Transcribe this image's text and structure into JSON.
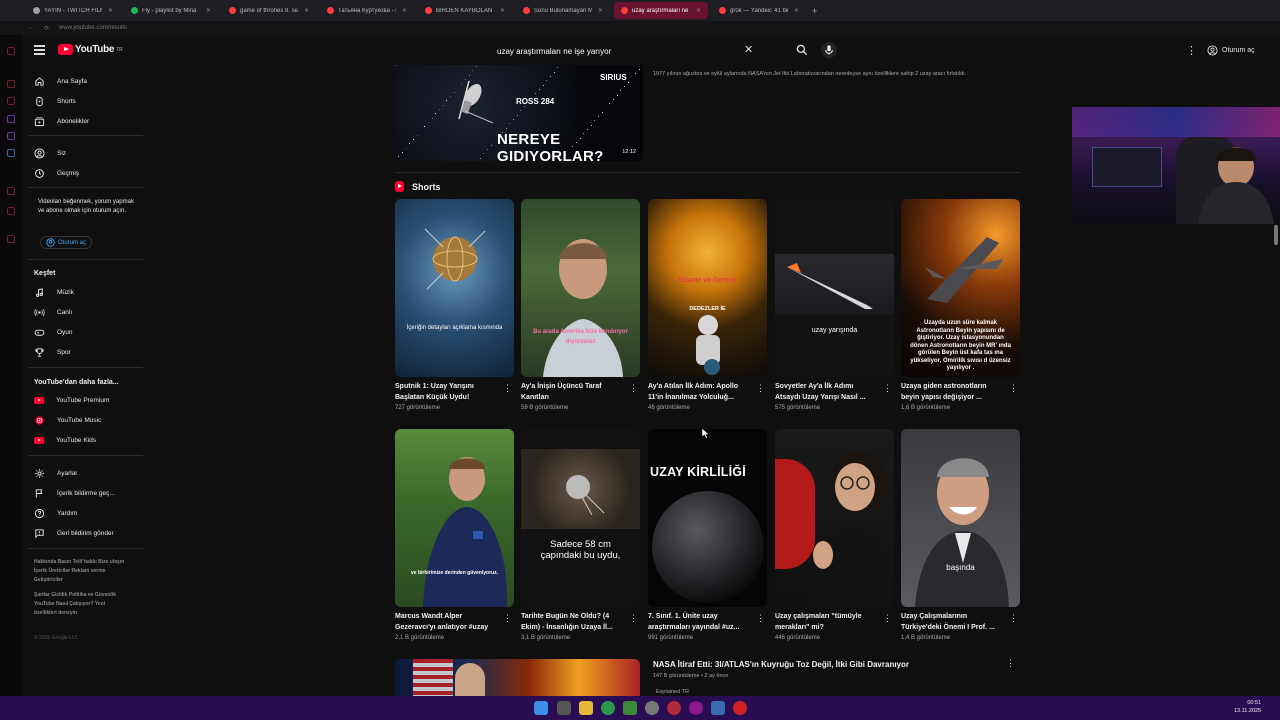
{
  "browser": {
    "tabs": [
      {
        "label": "YAYIN - TWITCH FILM B",
        "color": "#9aa0a6"
      },
      {
        "label": "Fly - playlist by Mina",
        "color": "#1db954"
      },
      {
        "label": "game of thrones 8. sez",
        "color": "#ff3b3b"
      },
      {
        "label": "Татьяна Куртукова - Ма",
        "color": "#ff3b3b"
      },
      {
        "label": "BIRDEN KAYBOLAN CIN",
        "color": "#ff3b3b"
      },
      {
        "label": "Sonu Bulunamayan Meg",
        "color": "#ff3b3b"
      },
      {
        "label": "uzay araştırmaları ne işe",
        "color": "#ff3b3b"
      },
      {
        "label": "grok — Yandex: 41 bin so",
        "color": "#ff3b3b"
      }
    ],
    "url": "www.youtube.com/results"
  },
  "header": {
    "logo_text": "YouTube",
    "logo_sup": "TR",
    "search_value": "uzay araştırmaları ne işe yarıyor",
    "signin_label": "Oturum aç"
  },
  "sidebar": {
    "main": [
      {
        "label": "Ana Sayfa"
      },
      {
        "label": "Shorts"
      },
      {
        "label": "Abonelikler"
      }
    ],
    "you": [
      {
        "label": "Siz"
      },
      {
        "label": "Geçmiş"
      }
    ],
    "signin_note": "Videoları beğenmek, yorum yapmak ve abone olmak için oturum açın.",
    "signin_button": "Oturum aç",
    "explore_heading": "Keşfet",
    "explore": [
      {
        "label": "Müzik"
      },
      {
        "label": "Canlı"
      },
      {
        "label": "Oyun"
      },
      {
        "label": "Spor"
      }
    ],
    "more_heading": "YouTube'dan daha fazla...",
    "more": [
      {
        "label": "YouTube Premium"
      },
      {
        "label": "YouTube Music"
      },
      {
        "label": "YouTube Kids"
      }
    ],
    "settings": [
      {
        "label": "Ayarlar"
      },
      {
        "label": "İçerik bildirme geç..."
      },
      {
        "label": "Yardım"
      },
      {
        "label": "Geri bildirim gönder"
      }
    ],
    "footer1": "Hakkında  Basın  Telif hakkı Bize ulaşın  İçerik Üreticiler Reklam verme  Geliştiriciler",
    "footer2": "Şartlar  Gizlilik Politika ve Güvenlik YouTube Nasıl Çalışıyor? Yeni özellikleri deneyin",
    "copyright": "© 2025 Google LLC"
  },
  "top_video": {
    "thumb_sirius": "SIRIUS",
    "thumb_ross": "ROSS 284",
    "thumb_text": "NEREYE GIDIYORLAR?",
    "duration": "12:12",
    "description": "1977 yılının ağustos ve eylül aylarında NASA'nın Jet Itki Laboratuvarından neredeyse aynı özelliklere sahip 2 uzay aracı fırlatıldı."
  },
  "shorts": {
    "heading": "Shorts",
    "items": [
      {
        "title": "Sputnik 1: Uzay Yarışını Başlatan Küçük Uydu!",
        "views": "727 görüntüleme",
        "caption": "İçeriğin detayları açıklama kısmında"
      },
      {
        "title": "Ay'a İnişin Üçüncü Taraf Kanıtları",
        "views": "59 B görüntüleme",
        "caption": "Bu arada Amerika bize kandırıyor diyorsanız"
      },
      {
        "title": "Ay'a Atılan İlk Adım: Apollo 11'in İnanılmaz Yolculuğ...",
        "views": "46 görüntüleme",
        "caption": "DEDEZLER İE",
        "caption_top": "Efsane ve Gerçek"
      },
      {
        "title": "Sovyetler Ay'a İlk Adımı Atsaydı Uzay Yarışı Nasıl ...",
        "views": "575 görüntüleme",
        "caption": "uzay yarışında"
      },
      {
        "title": "Uzaya giden astronotların beyin yapısı değişiyor ...",
        "views": "1,6 B görüntüleme",
        "caption": "Uzayda uzun süre kalmak Astronotların Beyin yapısını de ğiştiriyor. Uzay istasyonundan dönen Astronotların beyin MR' ında görülen Beyin üst kafa tas ına yükseliyor, Omirilik sıvısı d üzensiz yayılıyor ."
      },
      {
        "title": "Marcus Wandt Alper Gezeravcı'yı anlatıyor #uzay",
        "views": "2,1 B görüntüleme",
        "caption": "ve birbirimize derinden güveniyoruz."
      },
      {
        "title": "Tarihte Bugün Ne Oldu? (4 Ekim) - İnsanlığın Uzaya İl...",
        "views": "3,1 B görüntüleme",
        "caption": "Sadece 58 cm çapındaki bu uydu,"
      },
      {
        "title": "7. Sınıf. 1. Ünite uzay araştırmaları yayındal #uz...",
        "views": "991 görüntüleme",
        "caption": "UZAY KİRLİLİĞİ"
      },
      {
        "title": "Uzay çalışmaları \"tümüyle merakları\" mi?",
        "views": "446 görüntüleme",
        "caption": ""
      },
      {
        "title": "Uzay Çalışmalarının Türkiye'deki Önemi I Prof. ...",
        "views": "1,4 B görüntüleme",
        "caption": "başında"
      }
    ]
  },
  "long_video": {
    "title": "NASA İtiraf Etti: 3I/ATLAS'ın Kuyruğu Toz Değil, İtki Gibi Davranıyor",
    "meta": "147 B görüntüleme • 2 ay önce",
    "channel": "Explained TR"
  },
  "taskbar": {
    "time": "00:51",
    "date": "13.11.2025"
  }
}
